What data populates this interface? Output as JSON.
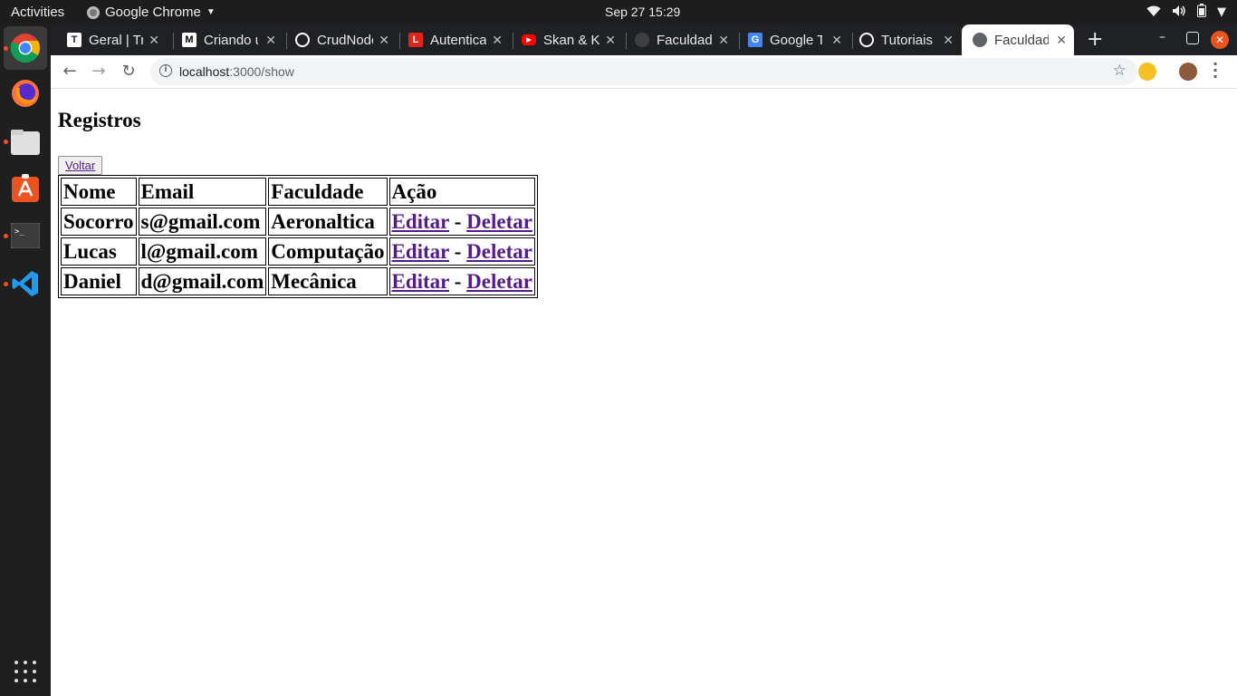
{
  "topbar": {
    "activities": "Activities",
    "app_name": "Google Chrome",
    "clock": "Sep 27  15:29"
  },
  "dock": {
    "items": [
      "chrome-icon",
      "firefox-icon",
      "files-icon",
      "software-icon",
      "terminal-icon",
      "vscode-icon"
    ]
  },
  "tabs": [
    {
      "label": "Geral | Trello",
      "favicon": "trello-icon",
      "color": "#ffffff"
    },
    {
      "label": "Criando uma",
      "favicon": "medium-icon",
      "color": "#000000"
    },
    {
      "label": "CrudNode",
      "favicon": "github-icon",
      "color": "#ffffff"
    },
    {
      "label": "Autenticação",
      "favicon": "l-icon",
      "color": "#e0241b"
    },
    {
      "label": "Skan & Krale",
      "favicon": "youtube-icon",
      "color": "#ff0000"
    },
    {
      "label": "Faculdade",
      "favicon": "globe-icon",
      "color": "#5f6368"
    },
    {
      "label": "Google Tradutor",
      "favicon": "translate-icon",
      "color": "#4285f4"
    },
    {
      "label": "Tutoriais",
      "favicon": "github-icon",
      "color": "#ffffff"
    },
    {
      "label": "Faculdade",
      "favicon": "globe-icon",
      "color": "#5f6368",
      "active": true
    }
  ],
  "address_bar": {
    "host": "localhost",
    "path": ":3000/show"
  },
  "page": {
    "heading": "Registros",
    "back_button": "Voltar",
    "table": {
      "headers": [
        "Nome",
        "Email",
        "Faculdade",
        "Ação"
      ],
      "rows": [
        {
          "nome": "Socorro",
          "email": "s@gmail.com",
          "faculdade": "Aeronaltica",
          "editar": "Editar",
          "sep": "-",
          "deletar": "Deletar"
        },
        {
          "nome": "Lucas",
          "email": "l@gmail.com",
          "faculdade": "Computação",
          "editar": "Editar",
          "sep": "-",
          "deletar": "Deletar"
        },
        {
          "nome": "Daniel",
          "email": "d@gmail.com",
          "faculdade": "Mecânica",
          "editar": "Editar",
          "sep": "-",
          "deletar": "Deletar"
        }
      ]
    }
  },
  "colors": {
    "link": "#551a8b",
    "ubuntu_accent": "#e95420",
    "tabstrip": "#202124"
  }
}
